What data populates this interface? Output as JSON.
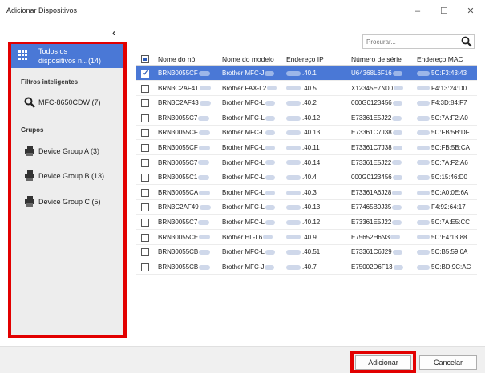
{
  "window": {
    "title": "Adicionar Dispositivos",
    "minimize": "–",
    "maximize": "☐",
    "close": "✕"
  },
  "sidebar": {
    "collapse": "‹",
    "all_devices": {
      "line1": "Todos os",
      "line2": "dispositivos n...",
      "count": "(14)"
    },
    "smart_filters_title": "Filtros inteligentes",
    "smart_filters": [
      {
        "label": "MFC-8650CDW (7)"
      }
    ],
    "groups_title": "Grupos",
    "groups": [
      {
        "label": "Device Group A (3)"
      },
      {
        "label": "Device Group B (13)"
      },
      {
        "label": "Device Group C (5)"
      }
    ]
  },
  "search": {
    "placeholder": "Procurar..."
  },
  "table": {
    "columns": [
      "Nome do nó",
      "Nome do modelo",
      "Endereço IP",
      "Número de série",
      "Endereço MAC"
    ],
    "rows": [
      {
        "name": "BRN30055CF",
        "model": "Brother MFC-J",
        "ip": ".40.1",
        "serial": "U64368L6F16",
        "mac": "5C:F3:43:43",
        "selected": true
      },
      {
        "name": "BRN3C2AF41",
        "model": "Brother FAX-L2",
        "ip": ".40.5",
        "serial": "X12345E7N00",
        "mac": "F4:13:24:D0",
        "selected": false
      },
      {
        "name": "BRN3C2AF43",
        "model": "Brother MFC-L",
        "ip": ".40.2",
        "serial": "000G0123456",
        "mac": "F4:3D:84:F7",
        "selected": false
      },
      {
        "name": "BRN30055C7",
        "model": "Brother MFC-L",
        "ip": ".40.12",
        "serial": "E73361E5J22",
        "mac": "5C:7A:F2:A0",
        "selected": false
      },
      {
        "name": "BRN30055CF",
        "model": "Brother MFC-L",
        "ip": ".40.13",
        "serial": "E73361C7J38",
        "mac": "5C:FB:5B:DF",
        "selected": false
      },
      {
        "name": "BRN30055CF",
        "model": "Brother MFC-L",
        "ip": ".40.11",
        "serial": "E73361C7J38",
        "mac": "5C:FB:5B:CA",
        "selected": false
      },
      {
        "name": "BRN30055C7",
        "model": "Brother MFC-L",
        "ip": ".40.14",
        "serial": "E73361E5J22",
        "mac": "5C:7A:F2:A6",
        "selected": false
      },
      {
        "name": "BRN30055C1",
        "model": "Brother MFC-L",
        "ip": ".40.4",
        "serial": "000G0123456",
        "mac": "5C:15:46:D0",
        "selected": false
      },
      {
        "name": "BRN30055CA",
        "model": "Brother MFC-L",
        "ip": ".40.3",
        "serial": "E73361A6J28",
        "mac": "5C:A0:0E:6A",
        "selected": false
      },
      {
        "name": "BRN3C2AF49",
        "model": "Brother MFC-L",
        "ip": ".40.13",
        "serial": "E77465B9J35",
        "mac": "F4:92:64:17",
        "selected": false
      },
      {
        "name": "BRN30055C7",
        "model": "Brother MFC-L",
        "ip": ".40.12",
        "serial": "E73361E5J22",
        "mac": "5C:7A:E5:CC",
        "selected": false
      },
      {
        "name": "BRN30055CE",
        "model": "Brother HL-L6",
        "ip": ".40.9",
        "serial": "E75652H6N3",
        "mac": "5C:E4:13:88",
        "selected": false
      },
      {
        "name": "BRN30055CB",
        "model": "Brother MFC-L",
        "ip": ".40.51",
        "serial": "E73361C6J29",
        "mac": "5C:B5:59:0A",
        "selected": false
      },
      {
        "name": "BRN30055CB",
        "model": "Brother MFC-J",
        "ip": ".40.7",
        "serial": "E75002D6F13",
        "mac": "5C:BD:9C:AC",
        "selected": false
      }
    ]
  },
  "footer": {
    "add_label": "Adicionar",
    "cancel_label": "Cancelar"
  },
  "colors": {
    "accent": "#4a78d6",
    "highlight": "#e20000"
  }
}
